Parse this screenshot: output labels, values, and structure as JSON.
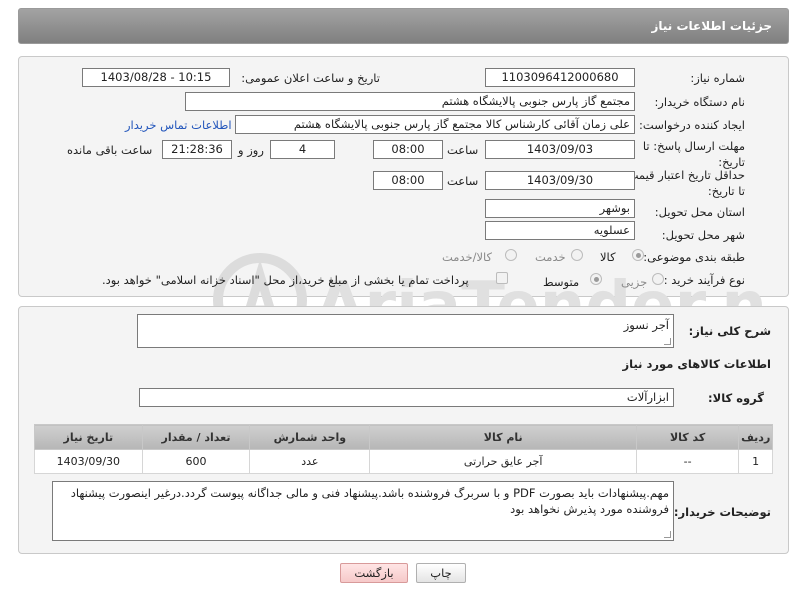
{
  "header": {
    "title": "جزئیات اطلاعات نیاز"
  },
  "form": {
    "need_number_label": "شماره نیاز:",
    "need_number": "1103096412000680",
    "announce_label": "تاریخ و ساعت اعلان عمومی:",
    "announce_value": "1403/08/28 - 10:15",
    "buyer_org_label": "نام دستگاه خریدار:",
    "buyer_org": "مجتمع گاز پارس جنوبی  پالایشگاه هشتم",
    "creator_label": "ایجاد کننده درخواست:",
    "creator": "علی زمان آقائی کارشناس کالا مجتمع گاز پارس جنوبی  پالایشگاه هشتم",
    "buyer_contact_link": "اطلاعات تماس خریدار",
    "reply_deadline_label": "مهلت ارسال پاسخ: تا تاریخ:",
    "reply_date": "1403/09/03",
    "time_label": "ساعت",
    "reply_time": "08:00",
    "days_value": "4",
    "days_label": "روز و",
    "remaining_time": "21:28:36",
    "remaining_label": "ساعت باقی مانده",
    "price_validity_label": "حداقل تاریخ اعتبار قیمت: تا تاریخ:",
    "price_date": "1403/09/30",
    "price_time": "08:00",
    "province_label": "استان محل تحویل:",
    "province": "بوشهر",
    "city_label": "شهر محل تحویل:",
    "city": "عسلویه",
    "category_label": "طبقه بندی موضوعی:",
    "category_options": [
      "کالا",
      "خدمت",
      "کالا/خدمت"
    ],
    "purchase_type_label": "نوع فرآیند خرید :",
    "purchase_options": [
      "جزیی",
      "متوسط"
    ],
    "payment_note": "پرداخت تمام یا بخشی از مبلغ خرید،از محل \"اسناد خزانه اسلامی\" خواهد بود."
  },
  "details": {
    "description_label": "شرح کلی نیاز:",
    "description": "آجر نسوز",
    "goods_info_title": "اطلاعات کالاهای مورد نیاز",
    "group_label": "گروه کالا:",
    "group_value": "ابزارآلات",
    "table": {
      "headers": [
        "ردیف",
        "کد کالا",
        "نام کالا",
        "واحد شمارش",
        "تعداد / مقدار",
        "تاریخ نیاز"
      ],
      "rows": [
        [
          "1",
          "--",
          "آجر عایق حرارتی",
          "عدد",
          "600",
          "1403/09/30"
        ]
      ]
    },
    "buyer_notes_label": "توضیحات خریدار:",
    "buyer_notes": "مهم.پیشنهادات باید بصورت PDF و با سربرگ فروشنده باشد.پیشنهاد فنی و مالی جداگانه پیوست گردد.درغیر اینصورت پیشنهاد فروشنده مورد پذیرش نخواهد بود"
  },
  "buttons": {
    "print": "چاپ",
    "back": "بازگشت"
  },
  "watermark": {
    "text": "AriaTender.neT"
  }
}
